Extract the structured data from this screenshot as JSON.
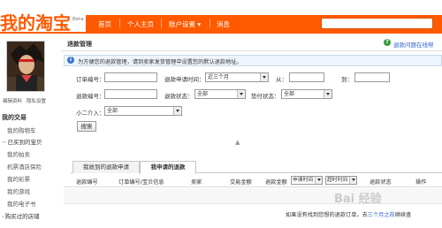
{
  "header": {
    "logo": "我的淘宝",
    "beta": "Beta",
    "nav": [
      "首页",
      "个人主页",
      "账户设置 ▾",
      "消息"
    ]
  },
  "sidebar": {
    "links": [
      "编辑资料",
      "隐私设置"
    ],
    "section": "我的交易",
    "items": [
      "我的购物车",
      "已买到的宝贝",
      "我的拍卖",
      "机票酒店保险",
      "我的彩票",
      "我的游戏",
      "我的电子书",
      "购买过的店铺"
    ],
    "expanded_index": 1,
    "collapsed_marker": "›",
    "expanded_marker": "−"
  },
  "main": {
    "title": "退款管理",
    "help": "退款问题在线帮",
    "notice": "为方便您的退款管理，请到卖家发货管理中设置您的默认退款地址。",
    "form": {
      "order_no_label": "订单编号：",
      "apply_time_label": "退款申请时间：",
      "apply_time_value": "近三个月",
      "from_label": "从：",
      "to_label": "到：",
      "refund_no_label": "退款编号：",
      "refund_status_label": "退款状态：",
      "refund_status_value": "全部",
      "dispute_status_label": "垫付状态：",
      "dispute_status_value": "全部",
      "xiaoer_label": "小二介入：",
      "xiaoer_value": "全部",
      "search_button": "搜索"
    },
    "collapse_marker": "▲",
    "tabs": [
      "我收到的退款申请",
      "我申请的退款"
    ],
    "active_tab": 1,
    "columns": [
      "退款编号",
      "订单编号/宝贝信息",
      "卖家",
      "交易金额",
      "退款金额",
      "超时时间",
      "退款状态",
      "操作"
    ],
    "apply_time_column": "申请时间",
    "empty_message_prefix": "如果没有找到您想的退款订单，去",
    "empty_message_link": "三个月之前",
    "empty_message_suffix": "继续查",
    "watermark": "Bai 经验"
  }
}
